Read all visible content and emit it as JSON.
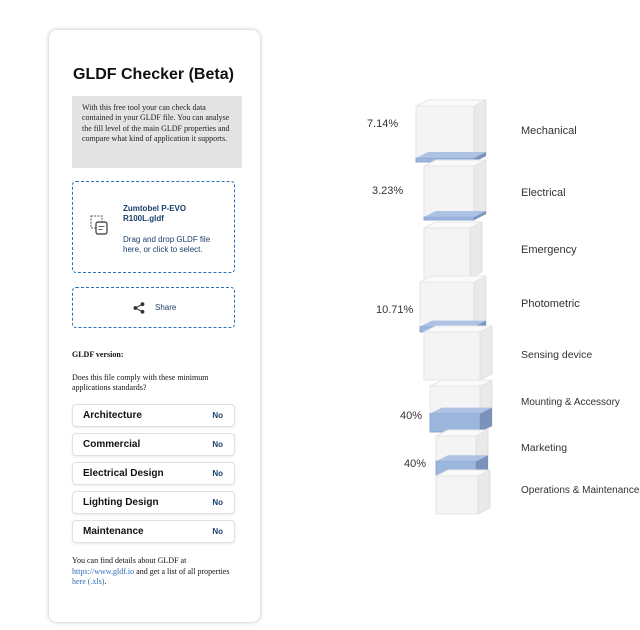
{
  "app": {
    "title": "GLDF Checker (Beta)",
    "intro": "With this free tool your can check data contained in your GLDF file. You can analyse the fill level of the main GLDF properties and compare what kind of application it supports."
  },
  "upload": {
    "file_name": "Zumtobel P-EVO R100L.gldf",
    "hint": "Drag and drop GLDF file here, or click to select."
  },
  "share": {
    "label": "Share"
  },
  "version": {
    "label": "GLDF version:"
  },
  "standards": {
    "question": "Does this file comply with these minimum applications standards?",
    "items": [
      {
        "name": "Architecture",
        "value": "No"
      },
      {
        "name": "Commercial",
        "value": "No"
      },
      {
        "name": "Electrical Design",
        "value": "No"
      },
      {
        "name": "Lighting Design",
        "value": "No"
      },
      {
        "name": "Maintenance",
        "value": "No"
      }
    ]
  },
  "footer": {
    "text1": "You can find details about GLDF at",
    "link1": "https://www.gldf.io",
    "text2": "and get a list of all properties",
    "link2": "here (.xls)",
    "text3": "."
  },
  "fill_levels": {
    "colors": {
      "fill": "#93afdc",
      "cube": "#f3f3f3"
    },
    "categories": [
      {
        "name": "Mechanical",
        "percent": "7.14%",
        "fraction": 0.0714
      },
      {
        "name": "Electrical",
        "percent": "3.23%",
        "fraction": 0.0323
      },
      {
        "name": "Emergency",
        "percent": "",
        "fraction": 0
      },
      {
        "name": "Photometric",
        "percent": "10.71%",
        "fraction": 0.1071
      },
      {
        "name": "Sensing device",
        "percent": "",
        "fraction": 0
      },
      {
        "name": "Mounting & Accessory",
        "percent": "40%",
        "fraction": 0.4
      },
      {
        "name": "Marketing",
        "percent": "40%",
        "fraction": 0.4
      },
      {
        "name": "Operations & Maintenance",
        "percent": "",
        "fraction": 0
      }
    ]
  }
}
